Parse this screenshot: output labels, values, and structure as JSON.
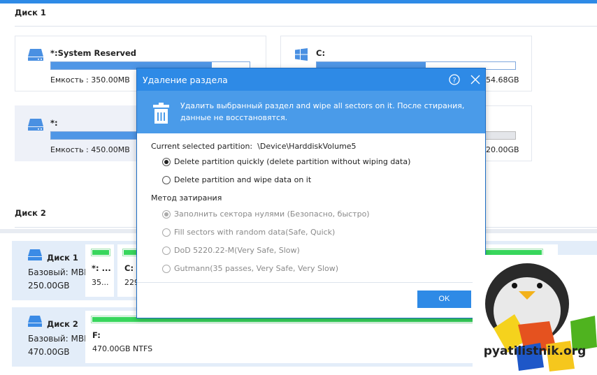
{
  "disk1_section": {
    "title": "Диск 1",
    "partitions": [
      {
        "name": "*:System Reserved",
        "capacity": "Емкость : 350.00MB",
        "usage_percent": 81,
        "icon": "drive-icon"
      },
      {
        "name": "C:",
        "capacity": "54.68GB",
        "usage_percent": 55,
        "icon": "windows-icon"
      },
      {
        "name": "*:",
        "capacity": "Емкость : 450.00MB",
        "usage_percent": 30,
        "icon": "drive-icon",
        "selected": true
      },
      {
        "name": "",
        "capacity": "20.00GB",
        "usage_percent": 0,
        "icon": "drive-icon"
      }
    ]
  },
  "disk2_section": {
    "title": "Диск 2"
  },
  "disk_map": [
    {
      "name": "Диск 1",
      "type": "Базовый: MBR",
      "size": "250.00GB",
      "partitions": [
        {
          "label": "*: ...",
          "size": "35..."
        },
        {
          "label": "C:",
          "size": "229"
        }
      ]
    },
    {
      "name": "Диск 2",
      "type": "Базовый: MBR",
      "size": "470.00GB",
      "partitions": [
        {
          "label": "F:",
          "size": "470.00GB NTFS"
        }
      ]
    }
  ],
  "dialog": {
    "title": "Удаление раздела",
    "info": "Удалить выбранный раздел and wipe all sectors on it. После стирания, данные не восстановятся.",
    "current_label": "Current selected partition:",
    "current_value": "\\Device\\HarddiskVolume5",
    "options": [
      {
        "label": "Delete partition quickly (delete partition without wiping data)",
        "checked": true
      },
      {
        "label": "Delete partition and wipe data on it",
        "checked": false
      }
    ],
    "method_label": "Метод затирания",
    "methods": [
      {
        "label": "Заполнить сектора нулями (Безопасно, быстро)",
        "checked": true
      },
      {
        "label": "Fill sectors with random data(Safe, Quick)",
        "checked": false
      },
      {
        "label": "DoD 5220.22-M(Very Safe, Slow)",
        "checked": false
      },
      {
        "label": "Gutmann(35 passes, Very Safe, Very Slow)",
        "checked": false
      }
    ],
    "ok_label": "OK"
  },
  "watermark": {
    "text": "pyatilistnik.org"
  },
  "colors": {
    "accent": "#2e8ae6",
    "green": "#38d65c"
  }
}
